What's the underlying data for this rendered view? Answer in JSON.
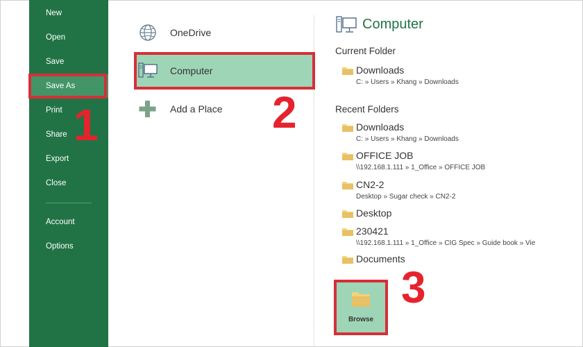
{
  "sidebar": {
    "items": [
      {
        "label": "New"
      },
      {
        "label": "Open"
      },
      {
        "label": "Save"
      },
      {
        "label": "Save As",
        "selected": true
      },
      {
        "label": "Print"
      },
      {
        "label": "Share"
      },
      {
        "label": "Export"
      },
      {
        "label": "Close"
      },
      {
        "label": "Account"
      },
      {
        "label": "Options"
      }
    ]
  },
  "places": [
    {
      "label": "OneDrive",
      "icon": "globe-icon"
    },
    {
      "label": "Computer",
      "icon": "computer-icon",
      "selected": true
    },
    {
      "label": "Add a Place",
      "icon": "plus-icon"
    }
  ],
  "right_panel": {
    "title": "Computer",
    "current_folder_heading": "Current Folder",
    "current_folder": {
      "name": "Downloads",
      "path": "C: » Users » Khang » Downloads"
    },
    "recent_folders_heading": "Recent Folders",
    "recent_folders": [
      {
        "name": "Downloads",
        "path": "C: » Users » Khang » Downloads"
      },
      {
        "name": "OFFICE JOB",
        "path": "\\\\192.168.1.111 » 1_Office » OFFICE JOB"
      },
      {
        "name": "CN2-2",
        "path": "Desktop » Sugar check » CN2-2"
      },
      {
        "name": "Desktop",
        "path": ""
      },
      {
        "name": "230421",
        "path": "\\\\192.168.1.111 » 1_Office » CIG Spec » Guide book » Vie"
      },
      {
        "name": "Documents",
        "path": ""
      }
    ],
    "browse_label": "Browse"
  },
  "annotations": {
    "step1": "1",
    "step2": "2",
    "step3": "3"
  },
  "colors": {
    "sidebar_bg": "#217346",
    "sidebar_selected": "#439467",
    "selected_place": "#9fd5b7",
    "title_green": "#217346",
    "annotation_red": "#d62f38",
    "folder_yellow": "#f2d27c"
  }
}
